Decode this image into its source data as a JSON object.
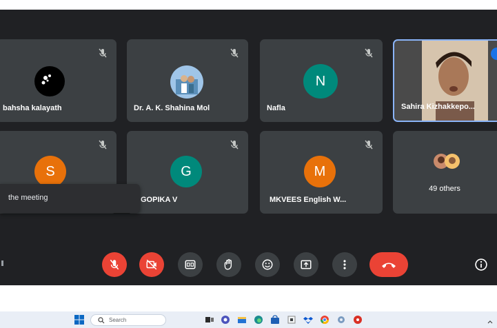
{
  "participants": [
    {
      "name": "bahsha kalayath",
      "avatar_type": "photo",
      "muted": true
    },
    {
      "name": "Dr. A. K. Shahina Mol",
      "avatar_type": "photo",
      "muted": true
    },
    {
      "name": "Nafla",
      "initial": "N",
      "avatar_color": "#00897b",
      "muted": true
    },
    {
      "name": "Sahira Kizhakkepo...",
      "avatar_type": "video",
      "speaking": true
    },
    {
      "name": "",
      "initial": "S",
      "avatar_color": "#e8710a",
      "muted": true
    },
    {
      "name": "GOPIKA V",
      "initial": "G",
      "avatar_color": "#00897b",
      "muted": true
    },
    {
      "name": "MKVEES English W...",
      "initial": "M",
      "avatar_color": "#e8710a",
      "muted": true
    },
    {
      "name": "49 others",
      "avatar_type": "group"
    }
  ],
  "tooltip": {
    "text": "the meeting"
  },
  "controls": [
    {
      "name": "mic-toggle",
      "icon": "mic-off-icon",
      "state": "off"
    },
    {
      "name": "camera-toggle",
      "icon": "video-off-icon",
      "state": "off"
    },
    {
      "name": "captions",
      "icon": "cc-icon"
    },
    {
      "name": "raise-hand",
      "icon": "hand-icon"
    },
    {
      "name": "reactions",
      "icon": "emoji-icon"
    },
    {
      "name": "present",
      "icon": "present-icon"
    },
    {
      "name": "more-options",
      "icon": "more-vert-icon"
    },
    {
      "name": "leave-call",
      "icon": "call-end-icon"
    },
    {
      "name": "meeting-info",
      "icon": "info-icon"
    }
  ],
  "taskbar": {
    "search_placeholder": "Search"
  },
  "colors": {
    "background": "#202124",
    "tile": "#3c4043",
    "red": "#ea4335",
    "speaking_border": "#8ab4f8"
  }
}
